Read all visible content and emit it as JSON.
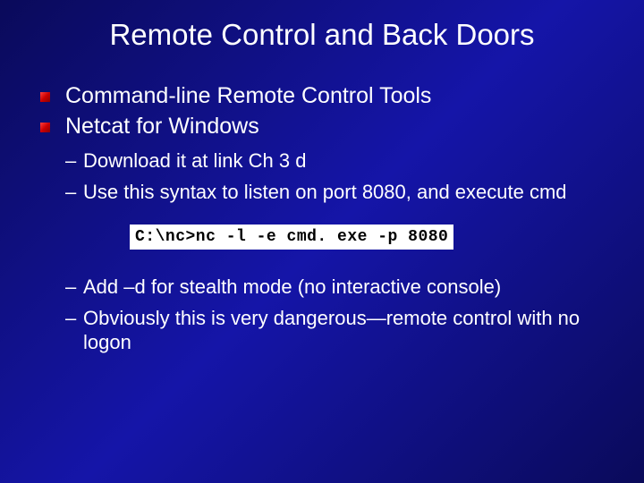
{
  "title": "Remote Control and Back Doors",
  "mainItems": [
    "Command-line Remote Control Tools",
    "Netcat for Windows"
  ],
  "subGroup1": [
    "Download it at link Ch 3 d",
    "Use this syntax to listen on port 8080, and execute cmd"
  ],
  "codeCommand": "C:\\nc>nc -l -e cmd. exe -p 8080",
  "subGroup2": [
    "Add –d for stealth mode (no interactive console)",
    "Obviously this is very dangerous—remote control with no logon"
  ]
}
